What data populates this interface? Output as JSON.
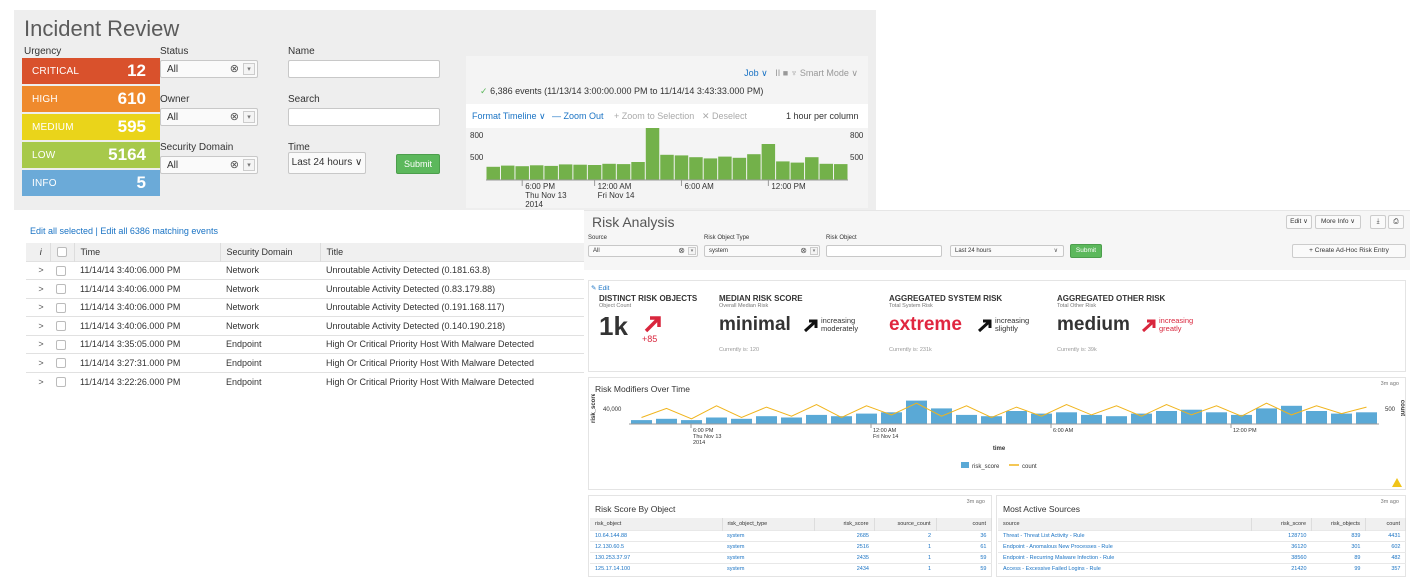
{
  "incident_review": {
    "title": "Incident Review",
    "urgency_label": "Urgency",
    "urgency": [
      {
        "name": "CRITICAL",
        "count": "12",
        "color": "#d9512c"
      },
      {
        "name": "HIGH",
        "count": "610",
        "color": "#ef8a2d"
      },
      {
        "name": "MEDIUM",
        "count": "595",
        "color": "#ead41a"
      },
      {
        "name": "LOW",
        "count": "5164",
        "color": "#a7c94b"
      },
      {
        "name": "INFO",
        "count": "5",
        "color": "#6baad8"
      }
    ],
    "status_label": "Status",
    "status_value": "All",
    "owner_label": "Owner",
    "owner_value": "All",
    "domain_label": "Security Domain",
    "domain_value": "All",
    "name_label": "Name",
    "search_label": "Search",
    "time_label": "Time",
    "time_value": "Last 24 hours ∨",
    "submit_label": "Submit",
    "timeline": {
      "job": "Job ∨",
      "controls": "II   ■   ♆ Smart Mode ∨",
      "events": "6,386 events (11/13/14 3:00:00.000 PM to 11/14/14 3:43:33.000 PM)",
      "format_timeline": "Format Timeline ∨",
      "zoom_out": "— Zoom Out",
      "zoom_to_selection": "+ Zoom to Selection",
      "deselect": "✕ Deselect",
      "per_column": "1 hour per column",
      "y_top": "800",
      "y_mid": "500",
      "bars": [
        220,
        240,
        230,
        245,
        235,
        260,
        255,
        250,
        270,
        265,
        300,
        900,
        420,
        410,
        380,
        360,
        390,
        370,
        430,
        600,
        310,
        290,
        380,
        270,
        265
      ],
      "ticks": [
        {
          "l1": "6:00 PM",
          "l2": "Thu Nov 13",
          "l3": "2014"
        },
        {
          "l1": "12:00 AM",
          "l2": "Fri Nov 14",
          "l3": ""
        },
        {
          "l1": "6:00 AM",
          "l2": "",
          "l3": ""
        },
        {
          "l1": "12:00 PM",
          "l2": "",
          "l3": ""
        }
      ]
    },
    "edit_links": "Edit all selected | Edit all 6386 matching events",
    "columns": [
      "i",
      "",
      "Time",
      "Security Domain",
      "Title"
    ],
    "rows": [
      {
        "time": "11/14/14 3:40:06.000 PM",
        "domain": "Network",
        "title": "Unroutable Activity Detected (0.181.63.8)"
      },
      {
        "time": "11/14/14 3:40:06.000 PM",
        "domain": "Network",
        "title": "Unroutable Activity Detected (0.83.179.88)"
      },
      {
        "time": "11/14/14 3:40:06.000 PM",
        "domain": "Network",
        "title": "Unroutable Activity Detected (0.191.168.117)"
      },
      {
        "time": "11/14/14 3:40:06.000 PM",
        "domain": "Network",
        "title": "Unroutable Activity Detected (0.140.190.218)"
      },
      {
        "time": "11/14/14 3:35:05.000 PM",
        "domain": "Endpoint",
        "title": "High Or Critical Priority Host With Malware Detected"
      },
      {
        "time": "11/14/14 3:27:31.000 PM",
        "domain": "Endpoint",
        "title": "High Or Critical Priority Host With Malware Detected"
      },
      {
        "time": "11/14/14 3:22:26.000 PM",
        "domain": "Endpoint",
        "title": "High Or Critical Priority Host With Malware Detected"
      }
    ]
  },
  "risk_analysis": {
    "title": "Risk Analysis",
    "edit_btn": "Edit ∨",
    "more_info_btn": "More Info ∨",
    "source_label": "Source",
    "source_value": "All",
    "rot_label": "Risk Object Type",
    "rot_value": "system",
    "ro_label": "Risk Object",
    "time_value": "Last 24 hours",
    "submit_label": "Submit",
    "create_btn": "+ Create Ad-Hoc Risk Entry",
    "edit_link": "✎ Edit",
    "kpis": [
      {
        "title": "DISTINCT RISK OBJECTS",
        "sub": "Object Count",
        "big": "1k",
        "delta": "+85",
        "trend": "",
        "current": "",
        "color": "#333333",
        "arrow_color": "#d9263d"
      },
      {
        "title": "MEDIAN RISK SCORE",
        "sub": "Overall Median Risk",
        "big": "minimal",
        "delta": "",
        "trend": "increasing moderately",
        "current": "Currently is: 120",
        "color": "#333333",
        "arrow_color": "#111111"
      },
      {
        "title": "AGGREGATED SYSTEM RISK",
        "sub": "Total System Risk",
        "big": "extreme",
        "delta": "",
        "trend": "increasing slightly",
        "current": "Currently is: 231k",
        "color": "#e0263f",
        "arrow_color": "#111111"
      },
      {
        "title": "AGGREGATED OTHER RISK",
        "sub": "Total Other Risk",
        "big": "medium",
        "delta": "",
        "trend": "increasing greatly",
        "current": "Currently is: 39k",
        "color": "#333333",
        "arrow_color": "#d9263d"
      }
    ],
    "modifiers": {
      "title": "Risk Modifiers Over Time",
      "ago": "3m ago",
      "y_label": "risk_score",
      "y_tick": "40,000",
      "y2_label": "count",
      "y2_tick": "500",
      "x_title": "time",
      "legend_score": "risk_score",
      "legend_count": "count",
      "ticks": [
        {
          "l1": "6:00 PM",
          "l2": "Thu Nov 13",
          "l3": "2014"
        },
        {
          "l1": "12:00 AM",
          "l2": "Fri Nov 14",
          "l3": ""
        },
        {
          "l1": "6:00 AM",
          "l2": "",
          "l3": ""
        },
        {
          "l1": "12:00 PM",
          "l2": "",
          "l3": ""
        }
      ],
      "bars": [
        3,
        4,
        3,
        5,
        4,
        6,
        5,
        7,
        6,
        8,
        9,
        18,
        12,
        7,
        6,
        10,
        8,
        9,
        7,
        6,
        8,
        10,
        11,
        9,
        7,
        12,
        14,
        10,
        8,
        9
      ],
      "line": [
        5,
        12,
        4,
        14,
        5,
        13,
        6,
        15,
        5,
        14,
        7,
        16,
        6,
        14,
        5,
        13,
        6,
        15,
        7,
        14,
        6,
        15,
        7,
        14,
        6,
        16,
        7,
        14,
        8,
        13
      ]
    },
    "by_object": {
      "title": "Risk Score By Object",
      "ago": "3m ago",
      "columns": [
        "risk_object",
        "risk_object_type",
        "risk_score",
        "source_count",
        "count"
      ],
      "rows": [
        [
          "10.64.144.88",
          "system",
          "2685",
          "2",
          "36"
        ],
        [
          "12.130.60.5",
          "system",
          "2516",
          "1",
          "61"
        ],
        [
          "130.253.37.97",
          "system",
          "2435",
          "1",
          "59"
        ],
        [
          "125.17.14.100",
          "system",
          "2434",
          "1",
          "59"
        ]
      ]
    },
    "sources": {
      "title": "Most Active Sources",
      "ago": "3m ago",
      "columns": [
        "source",
        "risk_score",
        "risk_objects",
        "count"
      ],
      "rows": [
        [
          "Threat - Threat List Activity - Rule",
          "128710",
          "839",
          "4431"
        ],
        [
          "Endpoint - Anomalous New Processes - Rule",
          "36120",
          "301",
          "602"
        ],
        [
          "Endpoint - Recurring Malware Infection - Rule",
          "38560",
          "89",
          "482"
        ],
        [
          "Access - Excessive Failed Logins - Rule",
          "21420",
          "99",
          "357"
        ]
      ]
    }
  }
}
